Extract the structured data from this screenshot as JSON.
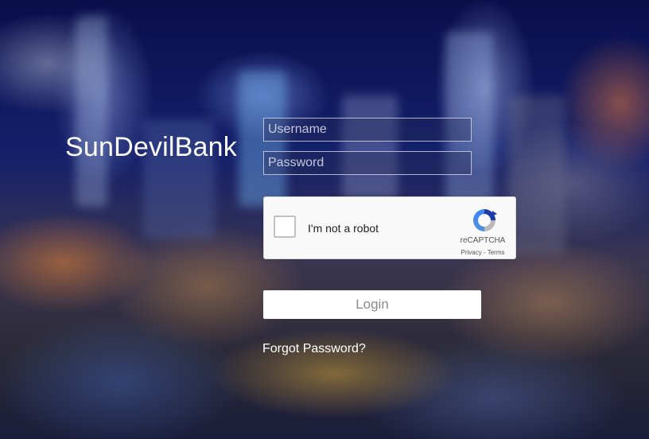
{
  "brand": {
    "name": "SunDevilBank"
  },
  "login_form": {
    "username_placeholder": "Username",
    "password_placeholder": "Password",
    "login_label": "Login",
    "forgot_password_label": "Forgot Password?"
  },
  "recaptcha": {
    "checkbox_label": "I'm not a robot",
    "brand": "reCAPTCHA",
    "privacy_label": "Privacy",
    "separator": " - ",
    "terms_label": "Terms",
    "logo_icon": "recaptcha-logo-icon"
  },
  "colors": {
    "background": "#0a0d3a",
    "text": "#ffffff",
    "button_background": "#ffffff",
    "button_text": "#8a8a8a"
  }
}
